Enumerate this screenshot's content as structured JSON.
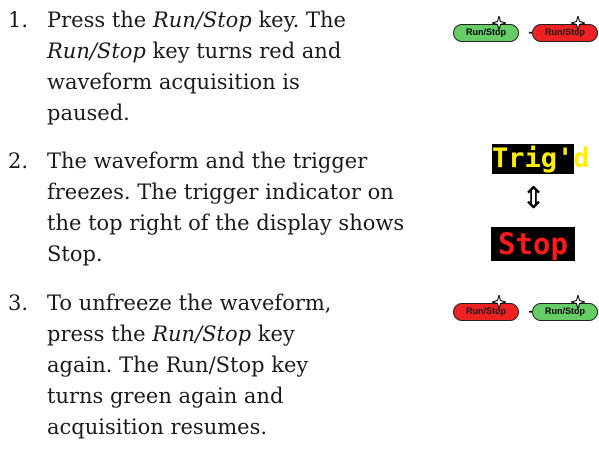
{
  "steps": [
    {
      "number": "1.",
      "lines": [
        [
          "Press the ",
          {
            "i": "Run/Stop"
          },
          " key. The"
        ],
        [
          {
            "i": "Run/Stop"
          },
          " key turns red and"
        ],
        [
          "waveform acquisition is"
        ],
        [
          "paused."
        ]
      ]
    },
    {
      "number": "2.",
      "lines": [
        [
          "The waveform and the trigger"
        ],
        [
          "freezes. The trigger indicator on"
        ],
        [
          "the top right of the display shows"
        ],
        [
          "Stop."
        ]
      ]
    },
    {
      "number": "3.",
      "lines": [
        [
          "To unfreeze the waveform,"
        ],
        [
          "press the ",
          {
            "i": "Run/Stop"
          },
          " key"
        ],
        [
          "again. The Run/Stop key"
        ],
        [
          "turns green again and"
        ],
        [
          "acquisition resumes."
        ]
      ]
    }
  ],
  "keys": {
    "run_stop_label": "Run/Stop",
    "arrow": "→",
    "green_color": "#66cc66",
    "red_color": "#ee2222"
  },
  "indicator": {
    "trigd_label": "Trig'd",
    "stop_label": "Stop",
    "updown_arrow": "⇕",
    "trigd_color": "#ffee00",
    "stop_color": "#ff1a1a"
  }
}
